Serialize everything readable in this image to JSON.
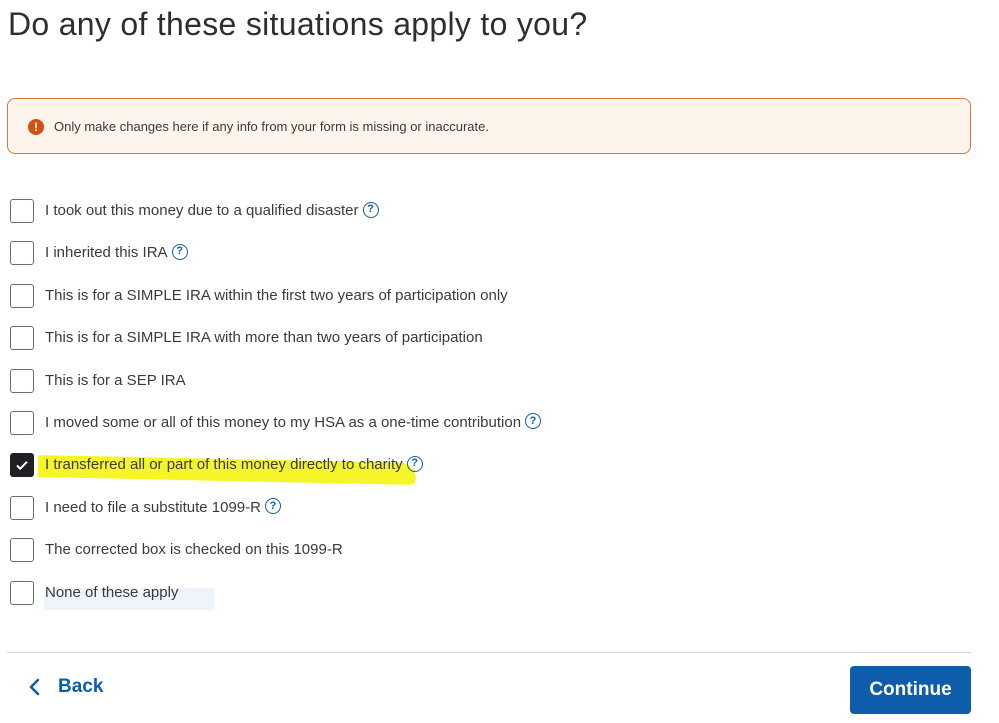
{
  "page": {
    "title": "Do any of these situations apply to you?"
  },
  "alert": {
    "icon": "exclamation-icon",
    "text": "Only make changes here if any info from your form is missing or inaccurate."
  },
  "options": [
    {
      "label": "I took out this money due to a qualified disaster",
      "checked": false,
      "help": true
    },
    {
      "label": "I inherited this IRA",
      "checked": false,
      "help": true
    },
    {
      "label": "This is for a SIMPLE IRA within the first two years of participation only",
      "checked": false,
      "help": false
    },
    {
      "label": "This is for a SIMPLE IRA with more than two years of participation",
      "checked": false,
      "help": false
    },
    {
      "label": "This is for a SEP IRA",
      "checked": false,
      "help": false
    },
    {
      "label": "I moved some or all of this money to my HSA as a one-time contribution",
      "checked": false,
      "help": true
    },
    {
      "label": "I transferred all or part of this money directly to charity",
      "checked": true,
      "help": true
    },
    {
      "label": "I need to file a substitute 1099-R",
      "checked": false,
      "help": true
    },
    {
      "label": "The corrected box is checked on this 1099-R",
      "checked": false,
      "help": false
    },
    {
      "label": "None of these apply",
      "checked": false,
      "help": false
    }
  ],
  "help_glyph": "?",
  "footer": {
    "back_label": "Back",
    "continue_label": "Continue"
  },
  "colors": {
    "primary": "#0d5dab",
    "alert_border": "#d8753a",
    "alert_bg": "#fdf4ec",
    "alert_icon": "#d4500f",
    "highlight": "#f6f52a"
  }
}
